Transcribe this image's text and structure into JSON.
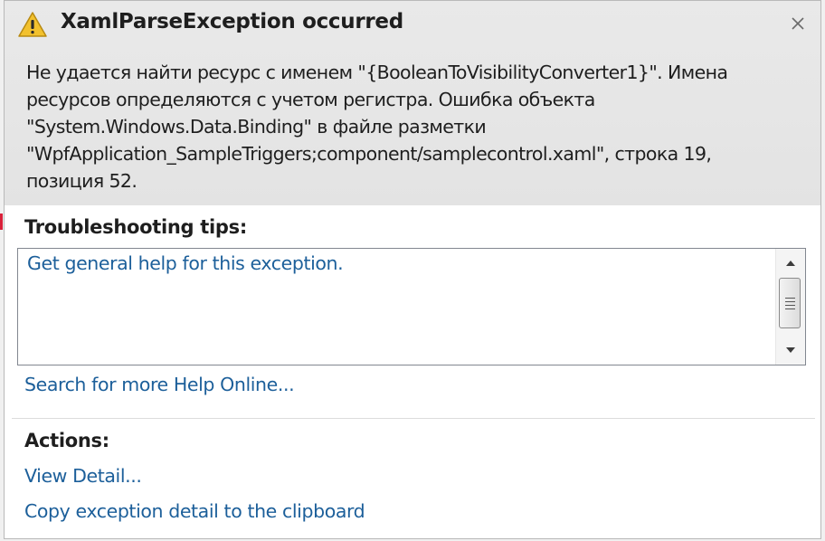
{
  "dialog": {
    "title": "XamlParseException occurred",
    "title_icon": "warning-icon",
    "close_icon": "close-icon",
    "message_lines": [
      "Не удается найти ресурс с именем \"{BooleanToVisibilityConverter1}\". Имена",
      "ресурсов определяются с учетом регистра.  Ошибка объекта",
      "\"System.Windows.Data.Binding\" в файле разметки",
      "\"WpfApplication_SampleTriggers;component/samplecontrol.xaml\", строка 19,",
      "позиция 52."
    ]
  },
  "troubleshooting": {
    "heading": "Troubleshooting tips:",
    "tips": [
      "Get general help for this exception."
    ],
    "search_link": "Search for more Help Online..."
  },
  "actions": {
    "heading": "Actions:",
    "items": [
      "View Detail...",
      "Copy exception detail to the clipboard"
    ]
  },
  "colors": {
    "link": "#1c5f9a",
    "header_bg": "#e6e6e6",
    "warning_fill": "#f2c12e"
  }
}
